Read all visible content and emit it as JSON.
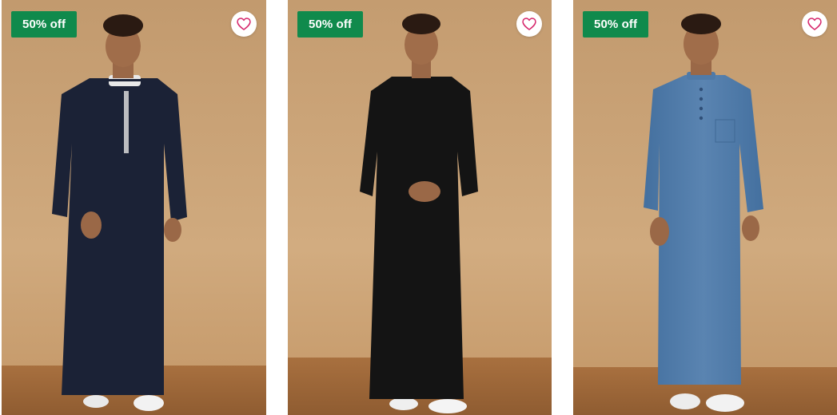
{
  "products": [
    {
      "badge": "50% off",
      "wishlist_icon": "heart-outline-icon",
      "photo_alt": "Man wearing navy thobe with embroidered placket",
      "colors": {
        "thobe": "#1b2236",
        "collar": "#e8e8e8",
        "embroidery": "#d8d8d8"
      }
    },
    {
      "badge": "50% off",
      "wishlist_icon": "heart-outline-icon",
      "photo_alt": "Man wearing black round-neck thobe",
      "colors": {
        "thobe": "#141414",
        "collar": "#141414",
        "embroidery": "#141414"
      }
    },
    {
      "badge": "50% off",
      "wishlist_icon": "heart-outline-icon",
      "photo_alt": "Man wearing denim blue thobe with mandarin collar",
      "colors": {
        "thobe": "#4f7aa8",
        "collar": "#4f7aa8",
        "embroidery": "#2f4f78"
      }
    }
  ],
  "theme": {
    "badge_bg": "#108a4c",
    "badge_text": "#ffffff",
    "heart_color": "#d6266b",
    "backdrop": "#c9a173",
    "floor": "#9e6a3c"
  }
}
